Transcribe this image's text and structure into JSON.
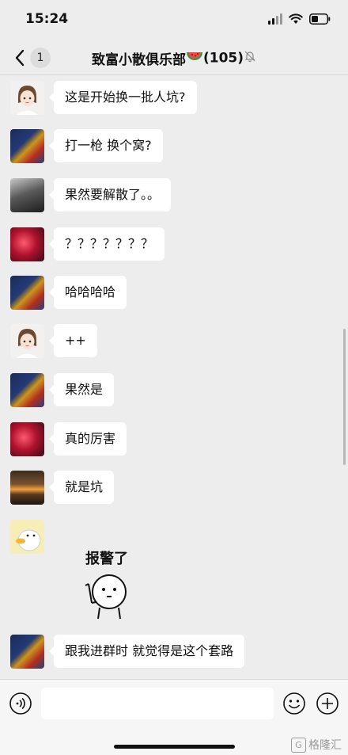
{
  "status_bar": {
    "time": "15:24",
    "icons": [
      "cellular-signal-icon",
      "wifi-icon",
      "battery-icon"
    ]
  },
  "nav": {
    "back_icon": "chevron-left-icon",
    "unread_count": "1",
    "group_name": "致富小散俱乐部",
    "title_emoji_icon": "watermelon-icon",
    "member_count": "(105)",
    "mute_icon": "bell-off-icon"
  },
  "messages": [
    {
      "avatar": "woman-cartoon-avatar",
      "text": "这是开始换一批人坑?"
    },
    {
      "avatar": "kids-photo-avatar",
      "text": "打一枪 换个窝?"
    },
    {
      "avatar": "dark-hair-photo-avatar",
      "text": "果然要解散了。。"
    },
    {
      "avatar": "red-light-photo-avatar",
      "text": "？？？？？？？"
    },
    {
      "avatar": "kids-photo-avatar",
      "text": "哈哈哈哈"
    },
    {
      "avatar": "woman-cartoon-avatar",
      "text": "++"
    },
    {
      "avatar": "kids-photo-avatar",
      "text": "果然是"
    },
    {
      "avatar": "red-light-photo-avatar",
      "text": "真的厉害"
    },
    {
      "avatar": "sunset-photo-avatar",
      "text": "就是坑"
    },
    {
      "avatar": "duck-cartoon-avatar",
      "sticker_text": "报警了",
      "sticker_icon": "phone-call-cartoon-icon"
    },
    {
      "avatar": "kids-photo-avatar",
      "text": "跟我进群时  就觉得是这个套路"
    }
  ],
  "input_bar": {
    "voice_icon": "voice-icon",
    "input_value": "",
    "emoji_icon": "emoji-icon",
    "plus_icon": "plus-icon"
  },
  "watermark": {
    "logo_letter": "G",
    "text": "格隆汇"
  },
  "colors": {
    "background": "#ededed",
    "bubble": "#ffffff",
    "input_bar": "#f6f6f6"
  }
}
